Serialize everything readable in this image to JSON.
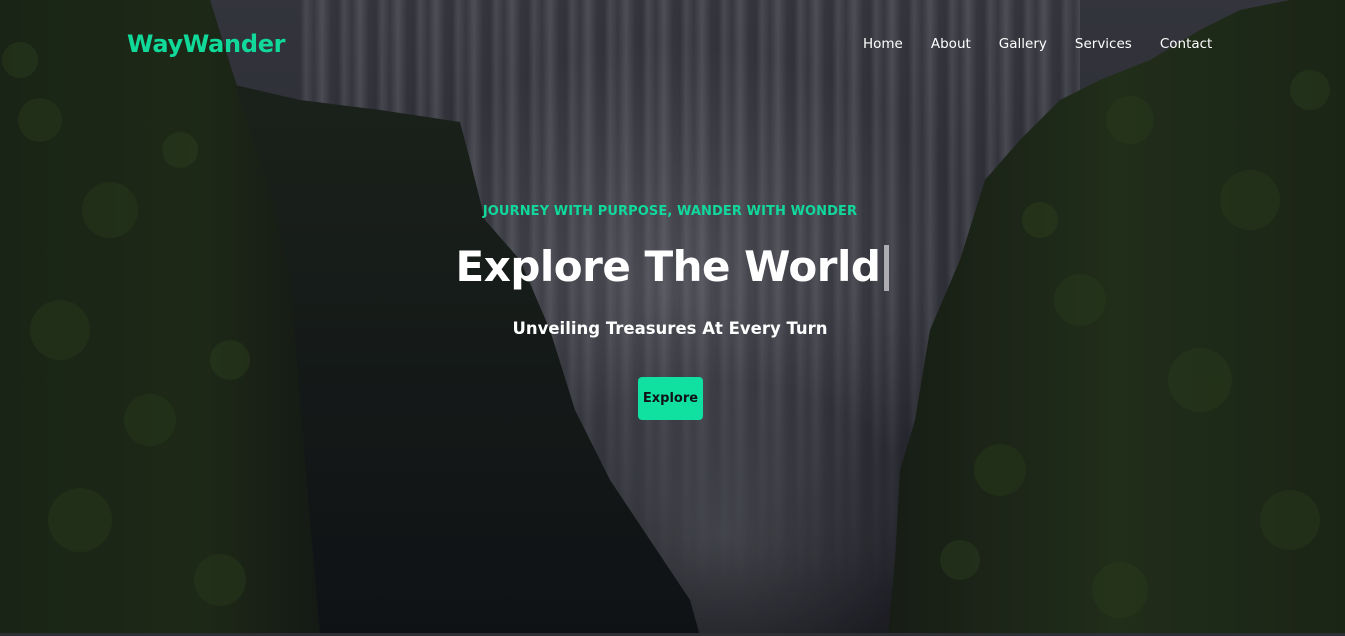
{
  "navbar": {
    "brand": "WayWander",
    "links": [
      "Home",
      "About",
      "Gallery",
      "Services",
      "Contact"
    ]
  },
  "hero": {
    "tagline": "JOURNEY WITH PURPOSE, WANDER WITH WONDER",
    "headline": "Explore The World",
    "subheadline": "Unveiling Treasures At Every Turn",
    "cta_label": "Explore"
  },
  "colors": {
    "accent": "#10d99a",
    "button": "#10e0a0",
    "text": "#ffffff"
  }
}
